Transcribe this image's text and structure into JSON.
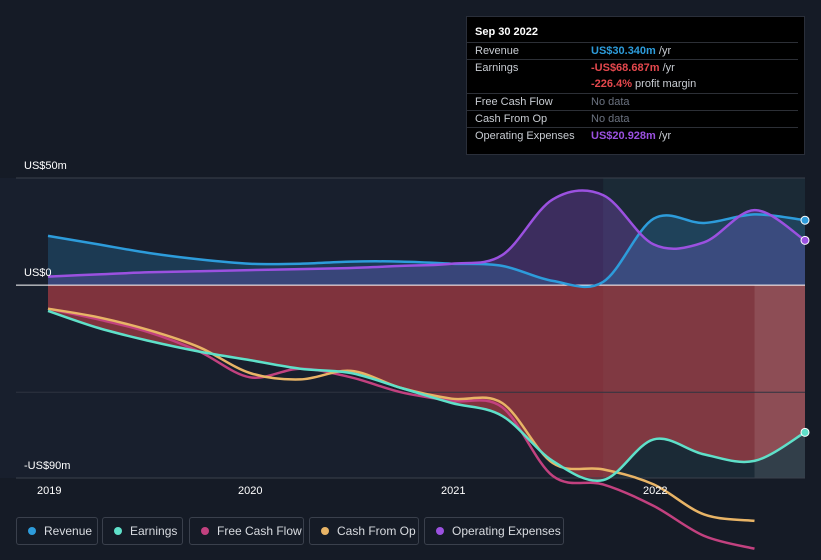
{
  "tooltip": {
    "date": "Sep 30 2022",
    "rows": [
      {
        "label": "Revenue",
        "value": "US$30.340m",
        "unit": "/yr",
        "color": "#2d9cdb"
      },
      {
        "label": "Earnings",
        "value": "-US$68.687m",
        "unit": "/yr",
        "color": "#e5484d"
      },
      {
        "label": "",
        "value": "-226.4%",
        "unit": "profit margin",
        "color": "#e5484d"
      },
      {
        "label": "Free Cash Flow",
        "value": "No data",
        "unit": "",
        "color": "#6b7280"
      },
      {
        "label": "Cash From Op",
        "value": "No data",
        "unit": "",
        "color": "#6b7280"
      },
      {
        "label": "Operating Expenses",
        "value": "US$20.928m",
        "unit": "/yr",
        "color": "#9b51e0"
      }
    ]
  },
  "y_axis": {
    "top_label": "US$50m",
    "zero_label": "US$0",
    "bottom_label": "-US$90m"
  },
  "x_axis": {
    "ticks": [
      "2019",
      "2020",
      "2021",
      "2022"
    ]
  },
  "legend": [
    {
      "label": "Revenue",
      "color": "#2d9cdb"
    },
    {
      "label": "Earnings",
      "color": "#5fe0c9"
    },
    {
      "label": "Free Cash Flow",
      "color": "#c2417f"
    },
    {
      "label": "Cash From Op",
      "color": "#e8b466"
    },
    {
      "label": "Operating Expenses",
      "color": "#9b51e0"
    }
  ],
  "chart_data": {
    "type": "line",
    "ylim": [
      -90,
      50
    ],
    "xlim": [
      2019.0,
      2022.75
    ],
    "y_ticks": [
      "US$50m",
      "US$0",
      "-US$90m"
    ],
    "x_ticks": [
      "2019",
      "2020",
      "2021",
      "2022"
    ],
    "highlight_start": 2021.75,
    "series": [
      {
        "name": "Revenue",
        "color": "#2d9cdb",
        "x": [
          2019.0,
          2019.25,
          2019.5,
          2019.75,
          2020.0,
          2020.25,
          2020.5,
          2020.75,
          2021.0,
          2021.25,
          2021.5,
          2021.75,
          2022.0,
          2022.25,
          2022.5,
          2022.75
        ],
        "y": [
          23,
          19,
          15,
          12,
          10,
          10,
          11,
          11,
          10,
          9,
          2,
          1.5,
          31,
          29,
          33,
          30.3
        ]
      },
      {
        "name": "Operating Expenses",
        "color": "#9b51e0",
        "x": [
          2019.0,
          2019.25,
          2019.5,
          2019.75,
          2020.0,
          2020.25,
          2020.5,
          2020.75,
          2021.0,
          2021.25,
          2021.5,
          2021.75,
          2022.0,
          2022.25,
          2022.5,
          2022.75
        ],
        "y": [
          4,
          5,
          6,
          6.5,
          7,
          7.5,
          8,
          9,
          10,
          14,
          40,
          42,
          19,
          20,
          35,
          20.9
        ]
      },
      {
        "name": "Earnings",
        "color": "#5fe0c9",
        "x": [
          2019.0,
          2019.25,
          2019.5,
          2019.75,
          2020.0,
          2020.25,
          2020.5,
          2020.75,
          2021.0,
          2021.25,
          2021.5,
          2021.75,
          2022.0,
          2022.25,
          2022.5,
          2022.75
        ],
        "y": [
          -12,
          -20,
          -26,
          -31,
          -35,
          -39,
          -41,
          -48,
          -55,
          -61,
          -82,
          -91,
          -72,
          -79,
          -82,
          -68.7
        ]
      },
      {
        "name": "Free Cash Flow",
        "color": "#c2417f",
        "x": [
          2019.0,
          2019.25,
          2019.5,
          2019.75,
          2020.0,
          2020.25,
          2020.5,
          2020.75,
          2021.0,
          2021.25,
          2021.5,
          2021.75,
          2022.0,
          2022.25,
          2022.5
        ],
        "y": [
          -11,
          -16,
          -22,
          -31,
          -43,
          -39,
          -43,
          -50,
          -54,
          -57,
          -89,
          -93,
          -103,
          -117,
          -123
        ]
      },
      {
        "name": "Cash From Op",
        "color": "#e8b466",
        "x": [
          2019.0,
          2019.25,
          2019.5,
          2019.75,
          2020.0,
          2020.25,
          2020.5,
          2020.75,
          2021.0,
          2021.25,
          2021.5,
          2021.75,
          2022.0,
          2022.25,
          2022.5
        ],
        "y": [
          -11,
          -15,
          -21,
          -29,
          -41,
          -44,
          -40,
          -48,
          -53,
          -55,
          -83,
          -86,
          -93,
          -107,
          -110
        ]
      }
    ]
  }
}
